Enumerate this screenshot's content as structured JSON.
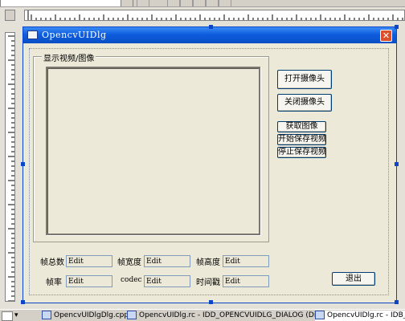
{
  "window": {
    "title": "OpencvUIDlg",
    "close_glyph": "✕"
  },
  "group": {
    "label": "显示视频/图像"
  },
  "buttons": {
    "open_camera": "打开摄像头",
    "close_camera": "关闭摄像头",
    "capture_image": "获取图像",
    "start_save_video": "开始保存视频",
    "stop_save_video": "停止保存视频",
    "exit": "退出"
  },
  "fields": {
    "total_frames": {
      "label": "帧总数",
      "value": "Edit"
    },
    "frame_width": {
      "label": "帧宽度",
      "value": "Edit"
    },
    "frame_height": {
      "label": "帧高度",
      "value": "Edit"
    },
    "frame_rate": {
      "label": "帧率",
      "value": "Edit"
    },
    "codec": {
      "label": "codec",
      "value": "Edit"
    },
    "timestamp": {
      "label": "时间戳",
      "value": "Edit"
    }
  },
  "taskbar": {
    "menu_glyph": "▾",
    "items": [
      "OpencvUIDlgDlg.cpp",
      "OpencvUIDlg.rc - IDD_OPENCVUIDLG_DIALOG (Dialog)",
      "OpencvUIDlg.rc - IDB_BL"
    ]
  },
  "icons": [
    "dialog-icon",
    "close-icon",
    "file-icon",
    "resource-icon"
  ]
}
